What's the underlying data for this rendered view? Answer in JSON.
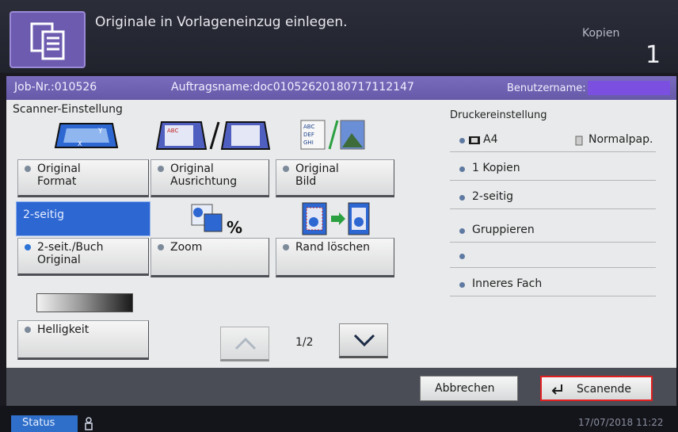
{
  "topbar": {
    "icon": "document-copy-icon",
    "message": "Originale in Vorlageneinzug einlegen.",
    "copies_label": "Kopien",
    "copies_value": "1"
  },
  "jobbar": {
    "job_nr": "Job-Nr.:010526",
    "job_name": "Auftragsname:doc01052620180717112147",
    "user_label": "Benutzername:",
    "user_value": ""
  },
  "scanner": {
    "title": "Scanner-Einstellung",
    "buttons": {
      "original_format": [
        "Original",
        "Format"
      ],
      "original_ausrichtung": [
        "Original",
        "Ausrichtung"
      ],
      "original_bild": [
        "Original",
        "Bild"
      ],
      "duplex_label": "2-seitig",
      "duplex_button": [
        "2-seit./Buch",
        "Original"
      ],
      "zoom": "Zoom",
      "rand_loeschen": "Rand löschen",
      "helligkeit": "Helligkeit"
    },
    "pager": {
      "current": "1/2",
      "up_icon": "chevron-up-icon",
      "down_icon": "chevron-down-icon"
    }
  },
  "printer": {
    "title": "Druckereinstellung",
    "items": [
      {
        "label": "A4",
        "extra": "Normalpap."
      },
      {
        "label": "1 Kopien"
      },
      {
        "label": "2-seitig"
      },
      {
        "label": "Gruppieren"
      },
      {
        "label": ""
      },
      {
        "label": "Inneres Fach"
      }
    ]
  },
  "actions": {
    "cancel": "Abbrechen",
    "scan_end": "Scanende"
  },
  "statusbar": {
    "status": "Status",
    "datetime": "17/07/2018 11:22"
  },
  "colors": {
    "accent": "#6659a8",
    "selected": "#2d67d2",
    "highlight": "#e02020"
  }
}
